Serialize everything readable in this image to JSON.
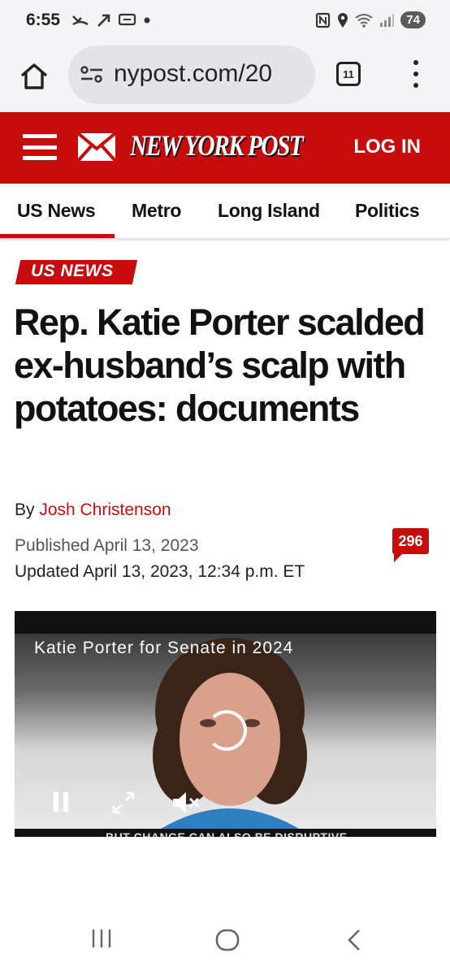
{
  "status_bar": {
    "time": "6:55",
    "battery": "74",
    "icons": [
      "missed-call-icon",
      "arrow-out-icon",
      "chat-icon",
      "dot-icon",
      "nfc-icon",
      "location-icon",
      "wifi-icon",
      "signal-icon"
    ]
  },
  "browser": {
    "url": "nypost.com/20",
    "tab_count": "11"
  },
  "site_header": {
    "logo": "NEW YORK POST",
    "login_label": "LOG IN",
    "brand_color": "#c60c0c"
  },
  "section_nav": {
    "items": [
      {
        "label": "US News",
        "active": true
      },
      {
        "label": "Metro",
        "active": false
      },
      {
        "label": "Long Island",
        "active": false
      },
      {
        "label": "Politics",
        "active": false
      }
    ]
  },
  "article": {
    "tag": "US NEWS",
    "headline": "Rep. Katie Porter scalded ex-husband’s scalp with potatoes: documents",
    "byline_prefix": "By ",
    "author": "Josh Christenson",
    "published": "Published April 13, 2023",
    "updated": "Updated April 13, 2023, 12:34 p.m. ET",
    "comment_count": "296"
  },
  "video": {
    "caption": "Katie Porter for Senate in 2024",
    "subtitle": "BUT CHANGE CAN ALSO BE DISRUPTIVE",
    "controls": [
      "pause-icon",
      "fullscreen-icon",
      "mute-icon"
    ]
  },
  "system_nav": {
    "buttons": [
      "recents-icon",
      "home-icon",
      "back-icon"
    ]
  }
}
